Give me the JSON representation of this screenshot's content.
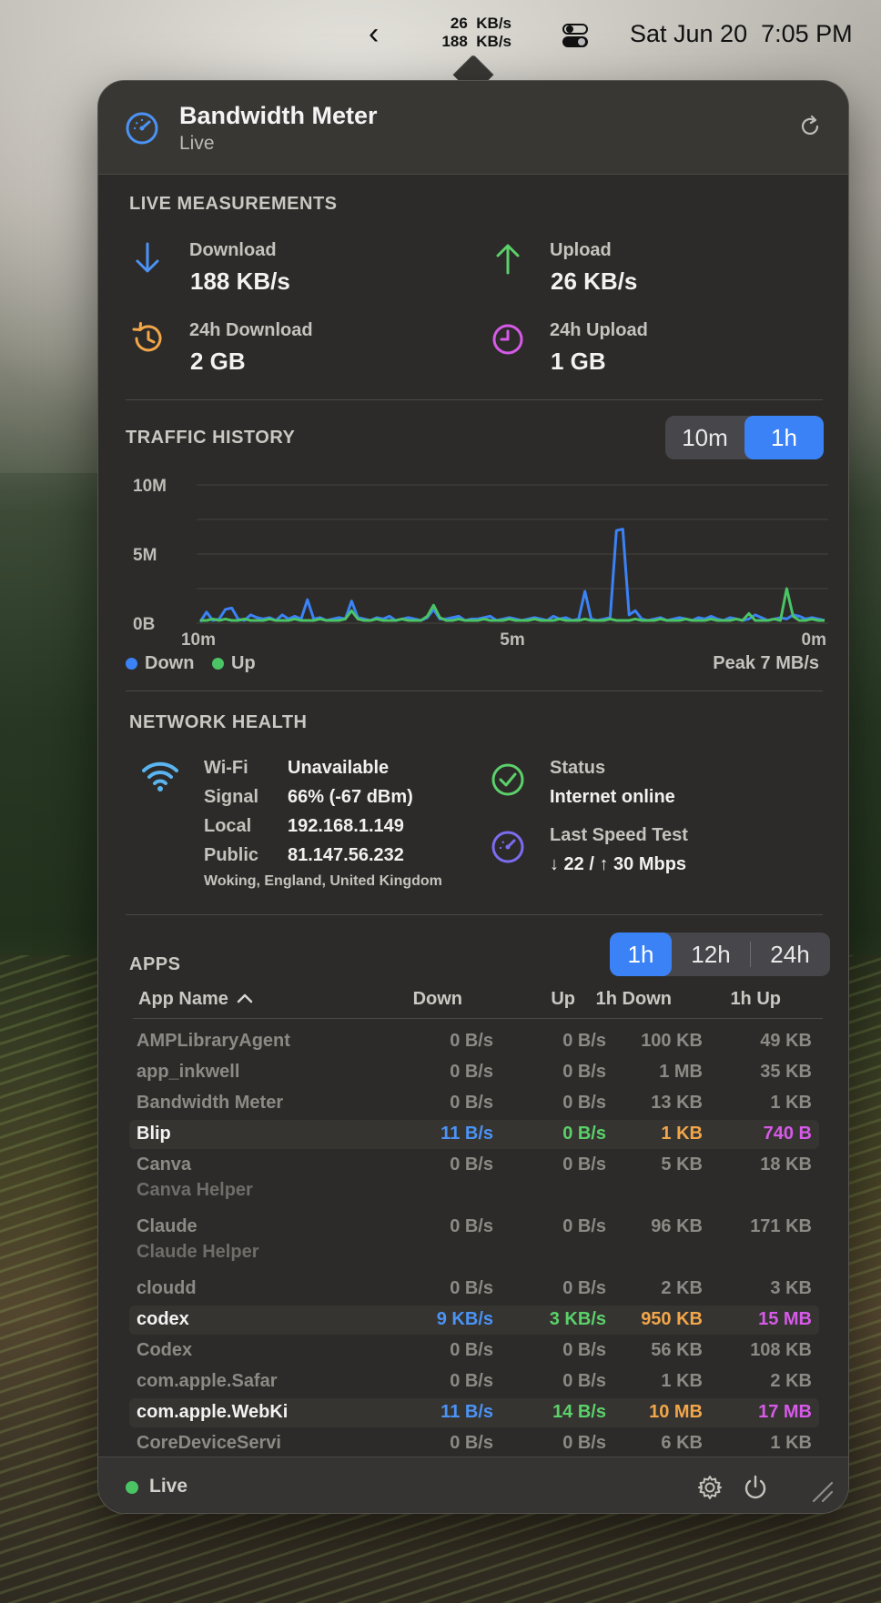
{
  "menubar": {
    "back_icon": "chevron-left-icon",
    "upload_rate": "26  KB/s",
    "download_rate": "188  KB/s",
    "control_center_icon": "control-center-icon",
    "clock": "Sat Jun 20  7:05 PM"
  },
  "header": {
    "title": "Bandwidth Meter",
    "subtitle": "Live",
    "icon": "speedometer-icon",
    "refresh_icon": "refresh-icon"
  },
  "live": {
    "section_label": "LIVE MEASUREMENTS",
    "download_label": "Download",
    "download_value": "188 KB/s",
    "upload_label": "Upload",
    "upload_value": "26 KB/s",
    "day_download_label": "24h Download",
    "day_download_value": "2 GB",
    "day_upload_label": "24h Upload",
    "day_upload_value": "1 GB",
    "colors": {
      "download": "#4b93f5",
      "upload": "#5bd16a",
      "day_download": "#f2a64a",
      "day_upload": "#d65ae8"
    }
  },
  "traffic": {
    "section_label": "TRAFFIC HISTORY",
    "ranges": [
      "10m",
      "1h"
    ],
    "selected_range": "1h",
    "legend_down": "Down",
    "legend_up": "Up",
    "peak": "Peak 7 MB/s"
  },
  "chart_data": {
    "type": "line",
    "y_ticks": [
      "10M",
      "5M",
      "0B"
    ],
    "x_ticks": [
      "10m",
      "5m",
      "0m"
    ],
    "ylim": [
      0,
      10
    ],
    "y_unit": "M",
    "grid": true,
    "legend": "bottom-left",
    "series": [
      {
        "name": "Down",
        "color": "#3b82f6",
        "values": [
          0.1,
          0.8,
          0.2,
          0.3,
          1.0,
          1.1,
          0.3,
          0.2,
          0.6,
          0.4,
          0.3,
          0.4,
          0.2,
          0.6,
          0.3,
          0.5,
          0.3,
          1.7,
          0.3,
          0.4,
          0.2,
          0.3,
          0.4,
          0.3,
          1.6,
          0.4,
          0.3,
          0.2,
          0.4,
          0.3,
          0.5,
          0.2,
          0.3,
          0.4,
          0.3,
          0.2,
          0.4,
          1.0,
          0.3,
          0.3,
          0.4,
          0.5,
          0.2,
          0.3,
          0.3,
          0.4,
          0.5,
          0.2,
          0.3,
          0.4,
          0.3,
          0.2,
          0.3,
          0.4,
          0.3,
          0.2,
          0.5,
          0.3,
          0.4,
          0.2,
          0.3,
          2.3,
          0.3,
          0.2,
          0.3,
          0.4,
          6.7,
          6.8,
          0.6,
          0.9,
          0.3,
          0.2,
          0.3,
          0.4,
          0.2,
          0.3,
          0.4,
          0.3,
          0.2,
          0.4,
          0.3,
          0.5,
          0.3,
          0.2,
          0.4,
          0.3,
          0.2,
          0.3,
          0.6,
          0.4,
          0.2,
          0.3,
          0.4,
          0.3,
          0.6,
          0.5,
          0.3,
          0.4,
          0.3,
          0.2
        ]
      },
      {
        "name": "Up",
        "color": "#4ac465",
        "values": [
          0.2,
          0.2,
          0.3,
          0.2,
          0.3,
          0.2,
          0.2,
          0.3,
          0.2,
          0.2,
          0.2,
          0.3,
          0.2,
          0.2,
          0.2,
          0.3,
          0.2,
          0.2,
          0.2,
          0.3,
          0.2,
          0.2,
          0.2,
          0.3,
          0.9,
          0.3,
          0.2,
          0.2,
          0.3,
          0.2,
          0.2,
          0.2,
          0.3,
          0.2,
          0.2,
          0.2,
          0.5,
          1.3,
          0.4,
          0.2,
          0.2,
          0.3,
          0.2,
          0.2,
          0.2,
          0.3,
          0.2,
          0.2,
          0.2,
          0.3,
          0.2,
          0.2,
          0.2,
          0.3,
          0.2,
          0.2,
          0.2,
          0.3,
          0.2,
          0.2,
          0.2,
          0.3,
          0.2,
          0.2,
          0.2,
          0.3,
          0.2,
          0.2,
          0.2,
          0.3,
          0.2,
          0.2,
          0.2,
          0.3,
          0.2,
          0.2,
          0.2,
          0.3,
          0.2,
          0.2,
          0.2,
          0.3,
          0.2,
          0.2,
          0.2,
          0.3,
          0.2,
          0.7,
          0.2,
          0.2,
          0.2,
          0.3,
          0.2,
          2.5,
          0.5,
          0.2,
          0.2,
          0.3,
          0.2,
          0.2
        ]
      }
    ]
  },
  "health": {
    "section_label": "NETWORK HEALTH",
    "wifi_label": "Wi-Fi",
    "wifi_value": "Unavailable",
    "signal_label": "Signal",
    "signal_value": "66% (-67 dBm)",
    "local_label": "Local",
    "local_value": "192.168.1.149",
    "public_label": "Public",
    "public_value": "81.147.56.232",
    "location": "Woking, England, United Kingdom",
    "status_label": "Status",
    "status_value": "Internet online",
    "speedtest_label": "Last Speed Test",
    "speedtest_value": "↓ 22 / ↑ 30 Mbps"
  },
  "apps": {
    "section_label": "APPS",
    "ranges": [
      "1h",
      "12h",
      "24h"
    ],
    "selected_range": "1h",
    "columns": {
      "name": "App Name",
      "down": "Down",
      "up": "Up",
      "range_down": "1h Down",
      "range_up": "1h Up"
    },
    "rows": [
      {
        "name": "AMPLibraryAgent",
        "down": "0 B/s",
        "up": "0 B/s",
        "range_down": "100 KB",
        "range_up": "49 KB",
        "active": false
      },
      {
        "name": "app_inkwell",
        "down": "0 B/s",
        "up": "0 B/s",
        "range_down": "1 MB",
        "range_up": "35 KB",
        "active": false
      },
      {
        "name": "Bandwidth Meter",
        "down": "0 B/s",
        "up": "0 B/s",
        "range_down": "13 KB",
        "range_up": "1 KB",
        "active": false
      },
      {
        "name": "Blip",
        "down": "11 B/s",
        "up": "0 B/s",
        "range_down": "1 KB",
        "range_up": "740 B",
        "active": true
      },
      {
        "name": "Canva",
        "down": "0 B/s",
        "up": "0 B/s",
        "range_down": "5 KB",
        "range_up": "18 KB",
        "active": false,
        "sub": "Canva Helper"
      },
      {
        "name": "Claude",
        "down": "0 B/s",
        "up": "0 B/s",
        "range_down": "96 KB",
        "range_up": "171 KB",
        "active": false,
        "sub": "Claude Helper"
      },
      {
        "name": "cloudd",
        "down": "0 B/s",
        "up": "0 B/s",
        "range_down": "2 KB",
        "range_up": "3 KB",
        "active": false
      },
      {
        "name": "codex",
        "down": "9 KB/s",
        "up": "3 KB/s",
        "range_down": "950 KB",
        "range_up": "15 MB",
        "active": true
      },
      {
        "name": "Codex",
        "down": "0 B/s",
        "up": "0 B/s",
        "range_down": "56 KB",
        "range_up": "108 KB",
        "active": false
      },
      {
        "name": "com.apple.Safar",
        "down": "0 B/s",
        "up": "0 B/s",
        "range_down": "1 KB",
        "range_up": "2 KB",
        "active": false
      },
      {
        "name": "com.apple.WebKi",
        "down": "11 B/s",
        "up": "14 B/s",
        "range_down": "10 MB",
        "range_up": "17 MB",
        "active": true
      },
      {
        "name": "CoreDeviceServi",
        "down": "0 B/s",
        "up": "0 B/s",
        "range_down": "6 KB",
        "range_up": "1 KB",
        "active": false
      }
    ]
  },
  "footer": {
    "status": "Live",
    "settings_icon": "gear-icon",
    "power_icon": "power-icon",
    "resize_icon": "resize-grip-icon"
  }
}
